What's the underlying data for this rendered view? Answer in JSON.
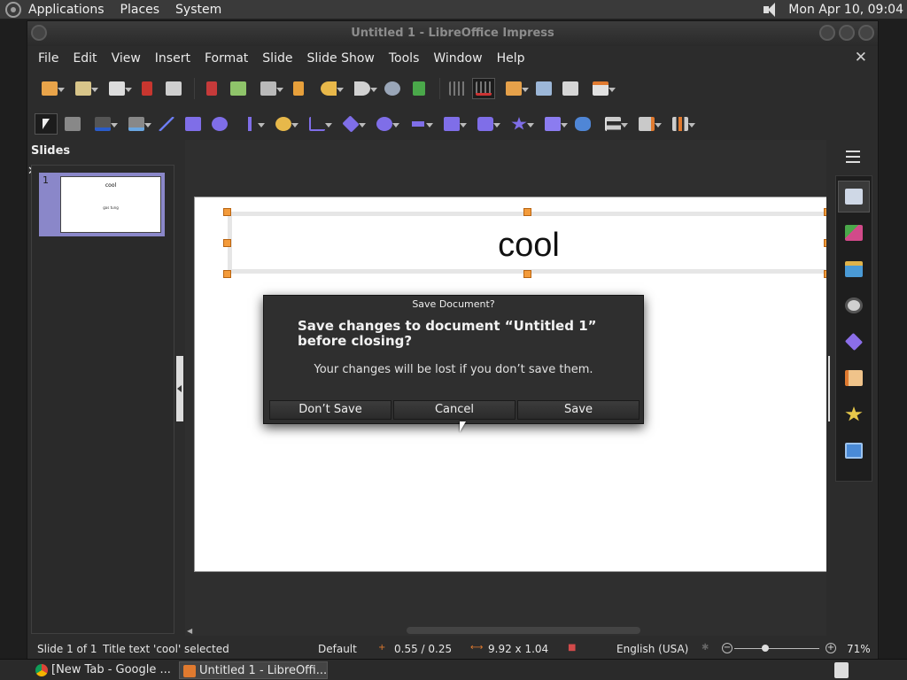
{
  "top_panel": {
    "menus": [
      "Applications",
      "Places",
      "System"
    ],
    "clock": "Mon Apr 10, 09:04"
  },
  "window": {
    "title": "Untitled 1 - LibreOffice Impress",
    "menu": [
      "File",
      "Edit",
      "View",
      "Insert",
      "Format",
      "Slide",
      "Slide Show",
      "Tools",
      "Window",
      "Help"
    ]
  },
  "slides_pane": {
    "header": "Slides",
    "thumbnails": [
      {
        "number": "1",
        "title": "cool",
        "subtitle": "gas tung"
      }
    ]
  },
  "slide": {
    "title_text": "cool"
  },
  "dialog": {
    "title": "Save Document?",
    "heading": "Save changes to document “Untitled 1” before closing?",
    "message": "Your changes will be lost if you don’t save them.",
    "buttons": {
      "dont_save": "Don’t Save",
      "cancel": "Cancel",
      "save": "Save"
    }
  },
  "statusbar": {
    "slide_info": "Slide 1 of 1",
    "selection": "Title text 'cool' selected",
    "layout": "Default",
    "position": "0.55 / 0.25",
    "size": "9.92 x 1.04",
    "language": "English (USA)",
    "zoom": "71%"
  },
  "taskbar": {
    "tasks": [
      "[New Tab - Google ...",
      "Untitled 1 - LibreOffi..."
    ]
  },
  "colors": {
    "accent": "#8a87c9",
    "handle": "#f39b3b",
    "dialog_bg": "#2f2f2f"
  }
}
